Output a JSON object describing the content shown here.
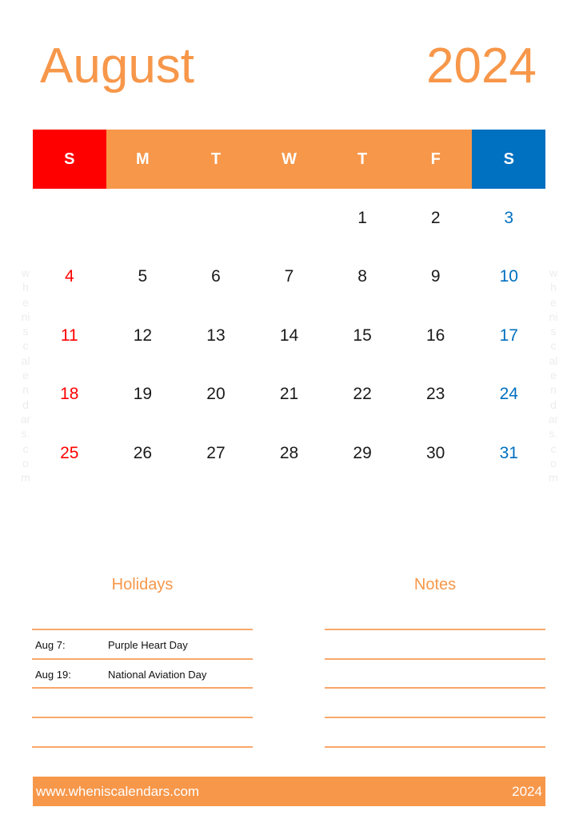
{
  "header": {
    "month": "August",
    "year": "2024"
  },
  "colors": {
    "accent": "#f7974a",
    "sunday": "#ff0000",
    "saturday": "#0070c0",
    "text": "#1a1a1a"
  },
  "weekdays": [
    "S",
    "M",
    "T",
    "W",
    "T",
    "F",
    "S"
  ],
  "weeks": [
    [
      "",
      "",
      "",
      "",
      "1",
      "2",
      "3"
    ],
    [
      "4",
      "5",
      "6",
      "7",
      "8",
      "9",
      "10"
    ],
    [
      "11",
      "12",
      "13",
      "14",
      "15",
      "16",
      "17"
    ],
    [
      "18",
      "19",
      "20",
      "21",
      "22",
      "23",
      "24"
    ],
    [
      "25",
      "26",
      "27",
      "28",
      "29",
      "30",
      "31"
    ]
  ],
  "watermark": [
    "w",
    "h",
    "e",
    "ni",
    "s",
    "c",
    "al",
    "e",
    "n",
    "d",
    "ar",
    "s.",
    "c",
    "o",
    "m"
  ],
  "holidays": {
    "title": "Holidays",
    "items": [
      {
        "date": "Aug 7:",
        "name": "Purple Heart Day"
      },
      {
        "date": "Aug 19:",
        "name": "National Aviation Day"
      }
    ]
  },
  "notes": {
    "title": "Notes"
  },
  "footer": {
    "website": "www.wheniscalendars.com",
    "year": "2024"
  }
}
